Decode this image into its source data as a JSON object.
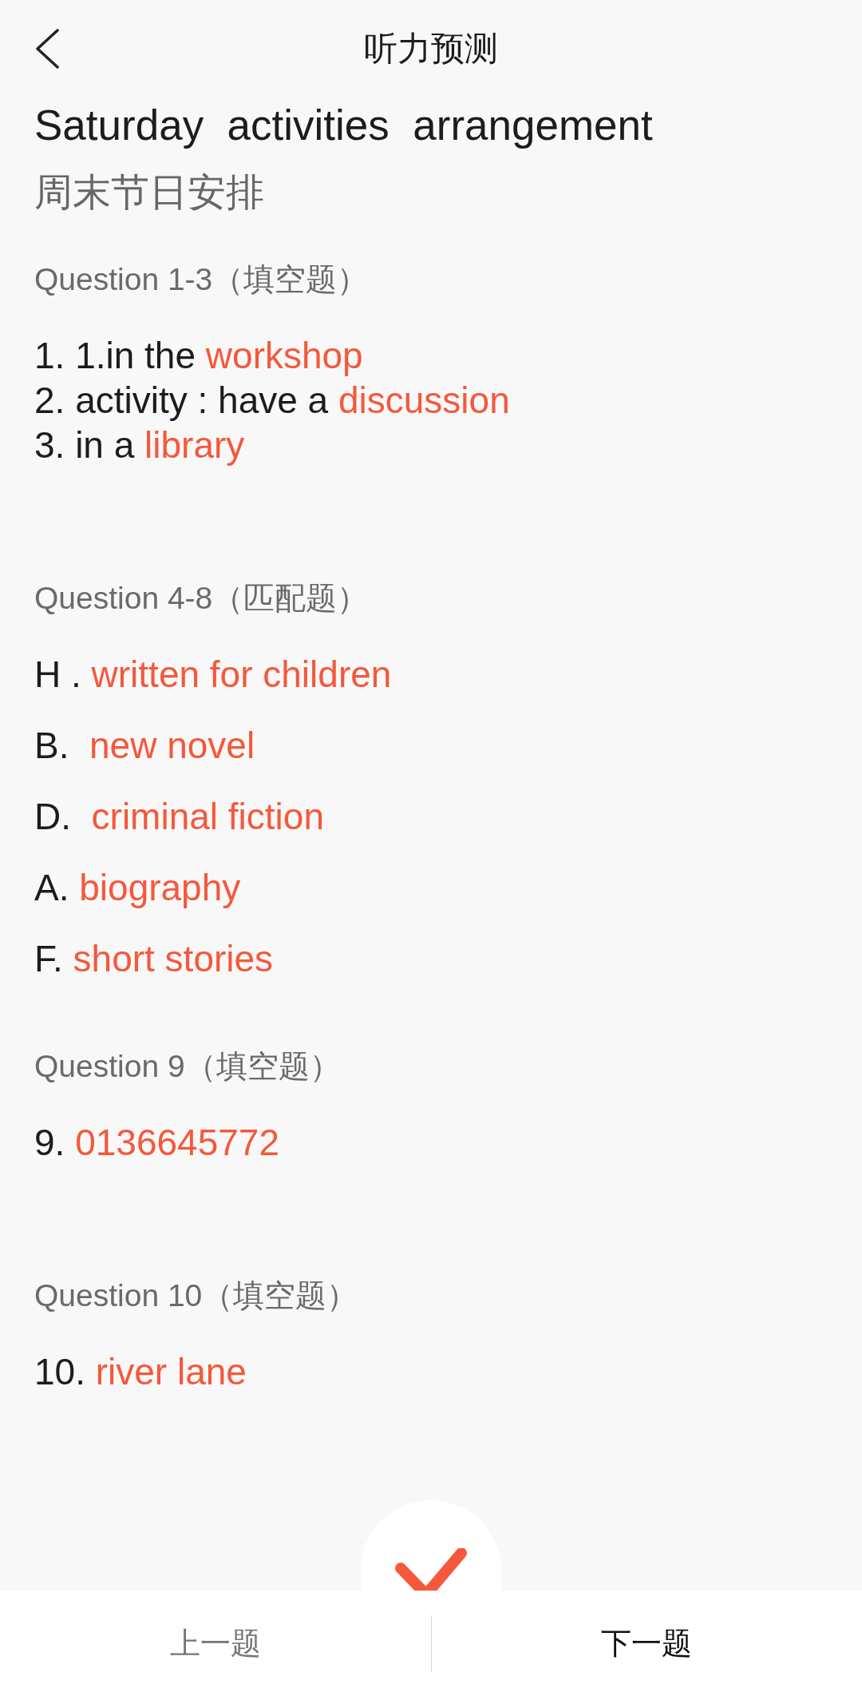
{
  "header": {
    "title": "听力预测"
  },
  "article": {
    "title": "Saturday  activities  arrangement",
    "subtitle": "周末节日安排"
  },
  "sections": [
    {
      "kind": "fill",
      "heading": "Question 1-3（填空题）",
      "answers": [
        {
          "label": "1. 1.in the ",
          "answer": "workshop"
        },
        {
          "label": "2. activity : have a ",
          "answer": "discussion"
        },
        {
          "label": "3. in a ",
          "answer": "library"
        }
      ]
    },
    {
      "kind": "match",
      "heading": "Question 4-8（匹配题）",
      "answers": [
        {
          "label": "H . ",
          "answer": "written for children"
        },
        {
          "label": "B.  ",
          "answer": "new novel"
        },
        {
          "label": "D.  ",
          "answer": "criminal fiction"
        },
        {
          "label": "A. ",
          "answer": "biography"
        },
        {
          "label": "F. ",
          "answer": "short stories"
        }
      ]
    },
    {
      "kind": "fill",
      "heading": "Question 9（填空题）",
      "answers": [
        {
          "label": "9. ",
          "answer": "0136645772"
        }
      ]
    },
    {
      "kind": "fill",
      "heading": "Question 10（填空题）",
      "answers": [
        {
          "label": "10. ",
          "answer": "river lane"
        }
      ]
    }
  ],
  "footer": {
    "buttons": [
      {
        "label": "上一题",
        "disabled": true
      },
      {
        "label": "下一题",
        "disabled": false
      }
    ]
  }
}
